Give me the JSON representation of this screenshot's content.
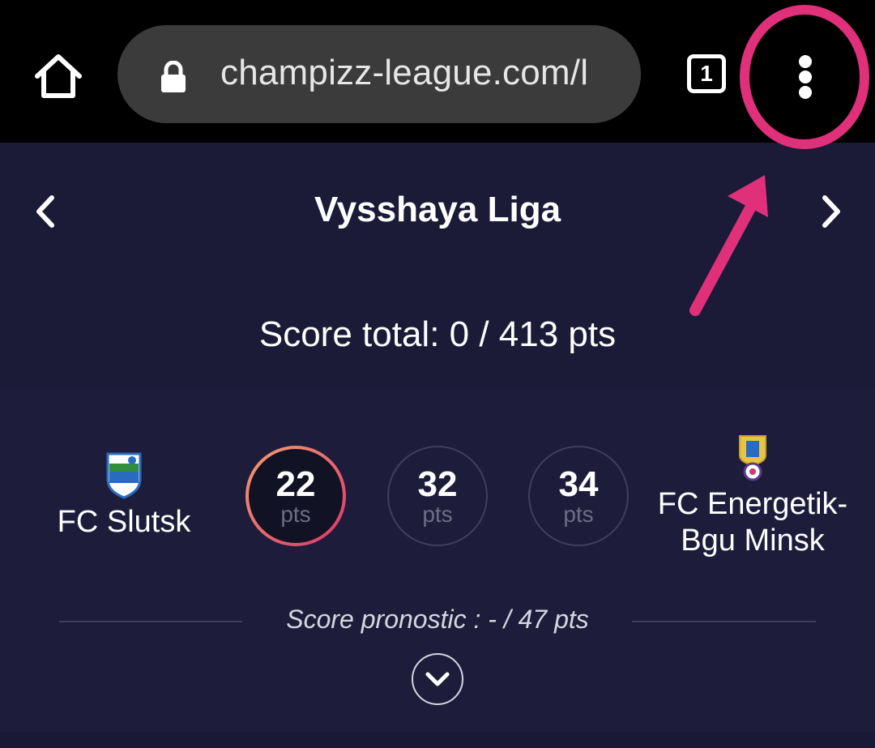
{
  "browser": {
    "url": "champizz-league.com/l",
    "tab_count": "1",
    "icons": {
      "home": "home-icon",
      "lock": "lock-icon",
      "tabs": "tab-switcher-icon",
      "menu": "more-vert-icon"
    }
  },
  "league": {
    "name": "Vysshaya Liga",
    "score_total": "Score total: 0 / 413 pts",
    "prev_icon": "chevron-left-icon",
    "next_icon": "chevron-right-icon"
  },
  "match": {
    "home_team": "FC Slutsk",
    "away_team_line1": "FC Energetik-",
    "away_team_line2": "Bgu Minsk",
    "options": [
      {
        "value": "22",
        "unit": "pts",
        "selected": true
      },
      {
        "value": "32",
        "unit": "pts",
        "selected": false
      },
      {
        "value": "34",
        "unit": "pts",
        "selected": false
      }
    ],
    "pronostic": "Score pronostic : - / 47 pts",
    "expand_icon": "chevron-down-icon"
  },
  "annotation": {
    "color": "#e0307a",
    "shapes": [
      "circle",
      "arrow"
    ]
  },
  "colors": {
    "background": "#1b1b38",
    "topbar": "#000000",
    "url_pill": "#3b3b3b",
    "selected_ring_start": "#f0a070",
    "selected_ring_end": "#e0336b"
  }
}
